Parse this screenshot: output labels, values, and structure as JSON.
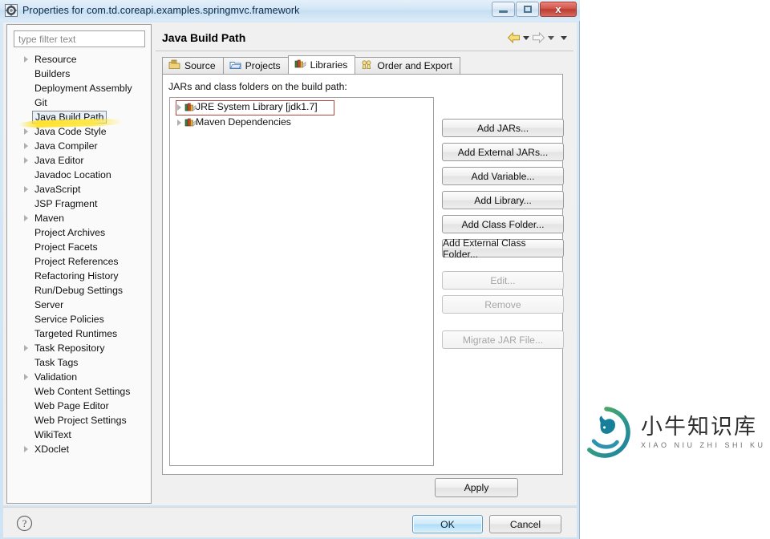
{
  "window": {
    "title": "Properties for com.td.coreapi.examples.springmvc.framework",
    "icon": "eclipse-properties-icon",
    "controls": {
      "minimize": "minimize-icon",
      "maximize": "maximize-icon",
      "close_label": "x"
    }
  },
  "sidebar": {
    "filter_placeholder": "type filter text",
    "items": [
      {
        "label": "Resource",
        "expandable": true,
        "selected": false
      },
      {
        "label": "Builders",
        "expandable": false,
        "selected": false
      },
      {
        "label": "Deployment Assembly",
        "expandable": false,
        "selected": false
      },
      {
        "label": "Git",
        "expandable": false,
        "selected": false
      },
      {
        "label": "Java Build Path",
        "expandable": false,
        "selected": true
      },
      {
        "label": "Java Code Style",
        "expandable": true,
        "selected": false
      },
      {
        "label": "Java Compiler",
        "expandable": true,
        "selected": false
      },
      {
        "label": "Java Editor",
        "expandable": true,
        "selected": false
      },
      {
        "label": "Javadoc Location",
        "expandable": false,
        "selected": false
      },
      {
        "label": "JavaScript",
        "expandable": true,
        "selected": false
      },
      {
        "label": "JSP Fragment",
        "expandable": false,
        "selected": false
      },
      {
        "label": "Maven",
        "expandable": true,
        "selected": false
      },
      {
        "label": "Project Archives",
        "expandable": false,
        "selected": false
      },
      {
        "label": "Project Facets",
        "expandable": false,
        "selected": false
      },
      {
        "label": "Project References",
        "expandable": false,
        "selected": false
      },
      {
        "label": "Refactoring History",
        "expandable": false,
        "selected": false
      },
      {
        "label": "Run/Debug Settings",
        "expandable": false,
        "selected": false
      },
      {
        "label": "Server",
        "expandable": false,
        "selected": false
      },
      {
        "label": "Service Policies",
        "expandable": false,
        "selected": false
      },
      {
        "label": "Targeted Runtimes",
        "expandable": false,
        "selected": false
      },
      {
        "label": "Task Repository",
        "expandable": true,
        "selected": false
      },
      {
        "label": "Task Tags",
        "expandable": false,
        "selected": false
      },
      {
        "label": "Validation",
        "expandable": true,
        "selected": false
      },
      {
        "label": "Web Content Settings",
        "expandable": false,
        "selected": false
      },
      {
        "label": "Web Page Editor",
        "expandable": false,
        "selected": false
      },
      {
        "label": "Web Project Settings",
        "expandable": false,
        "selected": false
      },
      {
        "label": "WikiText",
        "expandable": false,
        "selected": false
      },
      {
        "label": "XDoclet",
        "expandable": true,
        "selected": false
      }
    ]
  },
  "main": {
    "page_title": "Java Build Path",
    "nav": {
      "back_icon": "back-arrow-icon",
      "back_dropdown_icon": "chevron-down-icon",
      "forward_icon": "forward-arrow-icon",
      "forward_dropdown_icon": "chevron-down-icon",
      "menu_icon": "chevron-down-icon"
    },
    "tabs": [
      {
        "label": "Source",
        "icon": "source-folder-icon",
        "active": false
      },
      {
        "label": "Projects",
        "icon": "projects-folder-icon",
        "active": false
      },
      {
        "label": "Libraries",
        "icon": "libraries-books-icon",
        "active": true
      },
      {
        "label": "Order and Export",
        "icon": "order-export-icon",
        "active": false
      }
    ],
    "list_label": "JARs and class folders on the build path:",
    "libraries": [
      {
        "label": "JRE System Library [jdk1.7]",
        "icon": "library-books-icon",
        "annotated": true
      },
      {
        "label": "Maven Dependencies",
        "icon": "library-books-icon",
        "annotated": false
      }
    ],
    "buttons": [
      {
        "label": "Add JARs...",
        "enabled": true,
        "spacer": "none"
      },
      {
        "label": "Add External JARs...",
        "enabled": true,
        "spacer": "none"
      },
      {
        "label": "Add Variable...",
        "enabled": true,
        "spacer": "none"
      },
      {
        "label": "Add Library...",
        "enabled": true,
        "spacer": "none"
      },
      {
        "label": "Add Class Folder...",
        "enabled": true,
        "spacer": "none"
      },
      {
        "label": "Add External Class Folder...",
        "enabled": true,
        "spacer": "none"
      },
      {
        "label": "Edit...",
        "enabled": false,
        "spacer": "gap"
      },
      {
        "label": "Remove",
        "enabled": false,
        "spacer": "none"
      },
      {
        "label": "Migrate JAR File...",
        "enabled": false,
        "spacer": "gap2"
      }
    ],
    "apply_label": "Apply"
  },
  "footer": {
    "help_icon": "help-question-icon",
    "ok_label": "OK",
    "cancel_label": "Cancel"
  },
  "watermark": {
    "zh": "小牛知识库",
    "pinyin": "XIAO NIU ZHI SHI KU",
    "logo_icon": "calf-circle-logo-icon"
  },
  "colors": {
    "titlebar": "#d3e6f6",
    "close_button": "#c0463c",
    "annotation_red": "#b4443c",
    "highlight_yellow": "#ffe228",
    "ok_accent": "#aeddf6",
    "logo_green": "#6aab5a",
    "logo_teal": "#3f9bb5"
  }
}
